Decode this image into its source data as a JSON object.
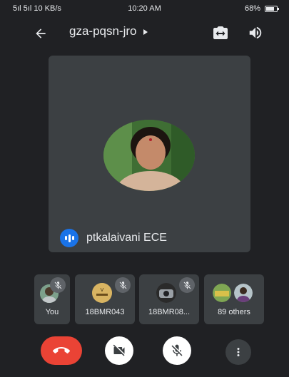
{
  "status_bar": {
    "signal_text": "5ıl 5ıl 10 KB/s",
    "time": "10:20 AM",
    "battery_percent": "68%",
    "battery_level": 0.68
  },
  "header": {
    "meeting_code": "gza-pqsn-jro",
    "back_icon": "arrow-left-icon",
    "switch_camera_icon": "switch-camera-icon",
    "speaker_icon": "speaker-icon"
  },
  "main_participant": {
    "name": "ptkalaivani ECE",
    "speaking_icon": "audio-wave-icon"
  },
  "participants": [
    {
      "label": "You",
      "muted": true
    },
    {
      "label": "18BMR043",
      "muted": true
    },
    {
      "label": "18BMR08...",
      "muted": true
    },
    {
      "label": "89 others",
      "muted": false
    }
  ],
  "controls": {
    "end_call_icon": "phone-hangup-icon",
    "camera_icon": "camera-off-icon",
    "mic_icon": "mic-off-icon",
    "more_icon": "more-vert-icon"
  },
  "colors": {
    "background": "#202124",
    "tile": "#3c4043",
    "end_call": "#ea4335",
    "speaking_accent": "#1a73e8"
  }
}
